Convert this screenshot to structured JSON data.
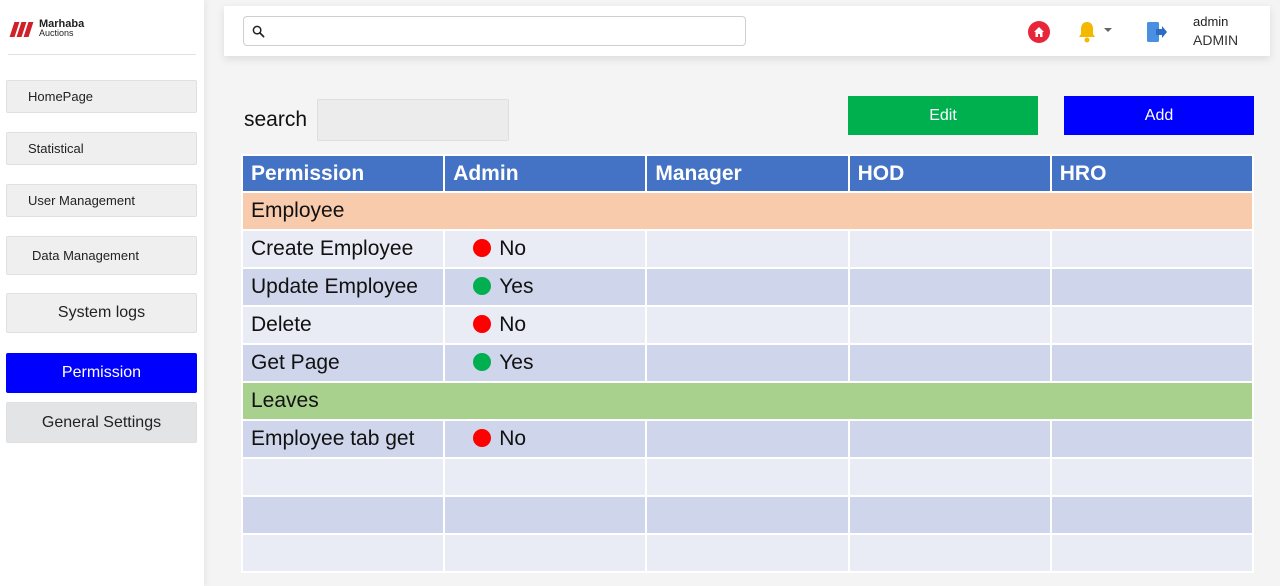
{
  "brand": {
    "name_line1": "Marhaba",
    "name_line2": "Auctions"
  },
  "sidebar": {
    "items": [
      {
        "label": "HomePage"
      },
      {
        "label": "Statistical"
      },
      {
        "label": "User Management"
      },
      {
        "label": "Data Management"
      },
      {
        "label": "System logs"
      },
      {
        "label": "Permission",
        "active": true
      },
      {
        "label": "General Settings"
      }
    ]
  },
  "topbar": {
    "search_placeholder": "",
    "icons": [
      "search-icon",
      "home-icon",
      "bell-icon",
      "chevron-down-icon",
      "logout-icon"
    ],
    "user": {
      "name": "admin",
      "role": "ADMIN"
    }
  },
  "toolbar": {
    "search_label": "search",
    "search_value": "",
    "edit_label": "Edit",
    "add_label": "Add"
  },
  "colors": {
    "accent_blue": "#0000ff",
    "edit_green": "#00b04f",
    "header_blue": "#4472c4",
    "group_employee": "#f8cbad",
    "group_leaves": "#a9d18e",
    "status_no": "#ff0000",
    "status_yes": "#00b050"
  },
  "table": {
    "columns": [
      "Permission",
      "Admin",
      "Manager",
      "HOD",
      "HRO"
    ],
    "groups": [
      {
        "name": "Employee",
        "rows": [
          {
            "permission": "Create Employee",
            "admin": "No"
          },
          {
            "permission": "Update Employee",
            "admin": "Yes"
          },
          {
            "permission": "Delete",
            "admin": "No"
          },
          {
            "permission": "Get Page",
            "admin": "Yes"
          }
        ]
      },
      {
        "name": "Leaves",
        "rows": [
          {
            "permission": "Employee tab get",
            "admin": "No"
          }
        ]
      }
    ]
  }
}
